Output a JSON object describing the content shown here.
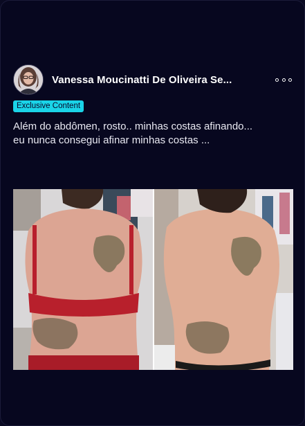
{
  "post": {
    "author": {
      "name": "Vanessa Moucinatti De Oliveira Se...",
      "avatar_icon": "user-avatar"
    },
    "badge_label": "Exclusive Content",
    "caption": "Além do abdômen,  rosto.. minhas costas afinando...\neu nunca consegui afinar minhas costas ...",
    "more_icon": "more-options-icon",
    "image": {
      "description_icon": "before-after-back-photo"
    }
  },
  "colors": {
    "background": "#07071f",
    "badge": "#1ad4e8",
    "text": "#e9e9f2"
  }
}
